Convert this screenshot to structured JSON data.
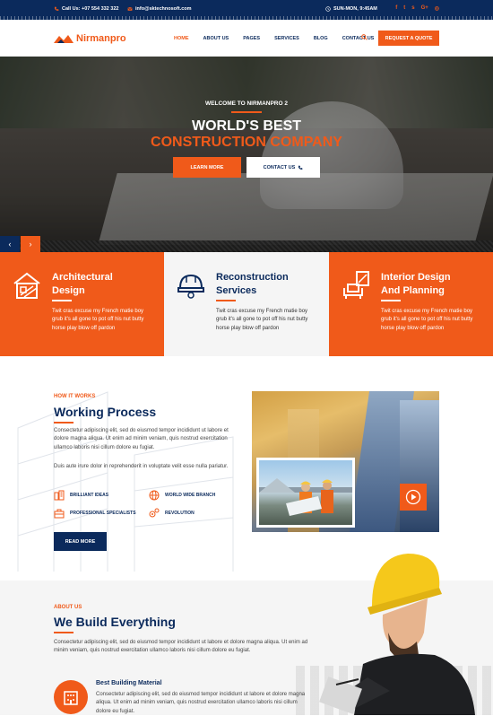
{
  "topbar": {
    "phone": "Call Us: +07 554 332 322",
    "email": "info@sktechnosoft.com",
    "hours": "SUN-MON, 9:45AM",
    "social_icons": [
      "facebook-icon",
      "twitter-icon",
      "skype-icon",
      "google-plus-icon",
      "instagram-icon"
    ],
    "social_glyphs": [
      "f",
      "t",
      "s",
      "G+",
      "◎"
    ]
  },
  "nav": {
    "logo_text": "Nirmanpro",
    "items": [
      "HOME",
      "ABOUT US",
      "PAGES",
      "SERVICES",
      "BLOG",
      "CONTACT US"
    ],
    "active_index": 0,
    "quote_button": "REQUEST A QUOTE"
  },
  "hero": {
    "welcome": "WELCOME TO NIRMANPRO 2",
    "title_line1": "WORLD'S BEST",
    "title_line2": "CONSTRUCTION COMPANY",
    "btn_primary": "LEARN MORE",
    "btn_secondary": "CONTACT US",
    "prev_arrow": "‹",
    "next_arrow": "›"
  },
  "features": [
    {
      "title_line1": "Architectural",
      "title_line2": "Design",
      "desc": "Twit cras excuse my French matie boy grub it's all gone to pot off his nut butty horse play blow off pardon",
      "icon": "house-blueprint-icon"
    },
    {
      "title_line1": "Reconstruction",
      "title_line2": "Services",
      "desc": "Twit cras excuse my French matie boy grub it's all gone to pot off his nut butty horse play blow off pardon",
      "icon": "helmet-icon"
    },
    {
      "title_line1": "Interior Design",
      "title_line2": "And Planning",
      "desc": "Twit cras excuse my French matie boy grub it's all gone to pot off his nut butty horse play blow off pardon",
      "icon": "armchair-icon"
    }
  ],
  "how": {
    "kicker": "HOW IT WORKS",
    "title": "Working Process",
    "para1": "Consectetur adipiscing elit, sed do eiusmod tempor incididunt ut labore et dolore magna aliqua. Ut enim ad minim veniam, quis nostrud exercitation ullamco laboris nisi cillum dolore eu fugiat.",
    "para2": "Duis aute irure dolor in reprehenderit in voluptate velit esse nulla pariatur.",
    "points": [
      "BRILLIANT IDEAS",
      "WORLD WIDE BRANCH",
      "PROFESSIONAL SPECIALISTS",
      "REVOLUTION"
    ],
    "read_more": "READ MORE"
  },
  "about": {
    "kicker": "ABOUT US",
    "title": "We Build Everything",
    "para": "Consectetur adipiscing elit, sed do eiusmod tempor incididunt ut labore et dolore magna aliqua. Ut enim ad minim veniam, quis nostrud exercitation ullamco laboris nisi cillum dolore eu fugiat.",
    "item_title": "Best Building Material",
    "item_desc": "Consectetur adipiscing elit, sed do eiusmod tempor incididunt ut labore et dolore magna aliqua. Ut enim ad minim veniam, quis nostrud exercitation ullamco laboris nisi cillum dolore eu fugiat."
  },
  "colors": {
    "navy": "#0b2a5c",
    "orange": "#f05a1a",
    "light": "#f5f5f5"
  }
}
